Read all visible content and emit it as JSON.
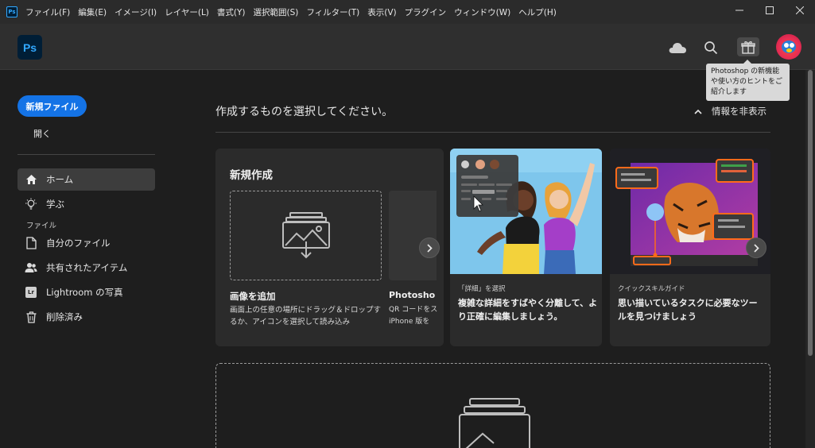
{
  "menubar": {
    "app_icon": "Ps",
    "items": [
      "ファイル(F)",
      "編集(E)",
      "イメージ(I)",
      "レイヤー(L)",
      "書式(Y)",
      "選択範囲(S)",
      "フィルター(T)",
      "表示(V)",
      "プラグイン",
      "ウィンドウ(W)",
      "ヘルプ(H)"
    ],
    "window_controls": [
      "minimize-icon",
      "maximize-icon",
      "close-icon"
    ]
  },
  "header": {
    "logo": "Ps",
    "icons": [
      "cloud-icon",
      "search-icon",
      "gift-icon",
      "avatar"
    ],
    "tooltip": "Photoshop の新機能や使い方のヒントをご紹介します"
  },
  "sidebar": {
    "new_file": "新規ファイル",
    "open": "開く",
    "items": [
      {
        "label": "ホーム",
        "icon": "home-icon",
        "active": true
      },
      {
        "label": "学ぶ",
        "icon": "lightbulb-icon",
        "active": false
      }
    ],
    "section_label": "ファイル",
    "file_items": [
      {
        "label": "自分のファイル",
        "icon": "document-icon"
      },
      {
        "label": "共有されたアイテム",
        "icon": "people-icon"
      },
      {
        "label": "Lightroom の写真",
        "icon": "lightroom-icon",
        "badge": "Lr"
      },
      {
        "label": "削除済み",
        "icon": "trash-icon"
      }
    ]
  },
  "main": {
    "title": "作成するものを選択してください。",
    "hide_info": "情報を非表示",
    "new_card": {
      "title": "新規作成",
      "add_image": "画像を追加",
      "add_image_desc": "画面上の任意の場所にドラッグ＆ドロップするか、アイコンを選択して読み込み",
      "next_label": "Photosho",
      "next_desc_1": "QR コードをス",
      "next_desc_2": "iPhone 版を"
    },
    "feature_cards": [
      {
        "eyebrow": "「詳細」を選択",
        "title": "複雑な詳細をすばやく分離して、より正確に編集しましょう。"
      },
      {
        "eyebrow": "クイックスキルガイド",
        "title": "思い描いているタスクに必要なツールを見つけましょう"
      }
    ]
  },
  "colors": {
    "accent": "#1473e6",
    "ps_blue": "#31a8ff",
    "background": "#1e1e1e",
    "card": "#2b2b2b"
  }
}
